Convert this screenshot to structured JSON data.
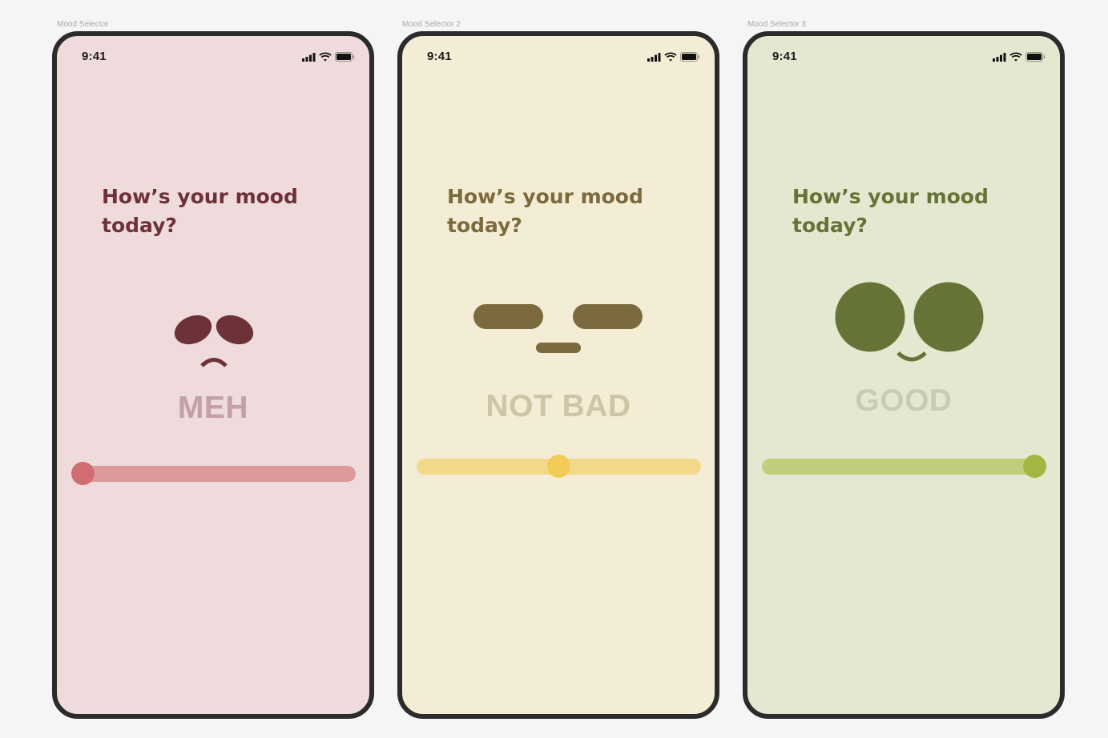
{
  "screens": [
    {
      "frame_label": "Mood Selector",
      "time": "9:41",
      "question": "How’s your mood today?",
      "mood": "MEH",
      "slider_value": 0,
      "colors": {
        "background": "#efdadc",
        "question": "#6d3237",
        "face": "#6d3237",
        "mood_word": "#c3a0a5",
        "track": "#dd9a9c",
        "thumb": "#d06c72"
      }
    },
    {
      "frame_label": "Mood Selector 2",
      "time": "9:41",
      "question": "How’s your mood today?",
      "mood": "NOT BAD",
      "slider_value": 0.5,
      "colors": {
        "background": "#f4edd5",
        "question": "#7b6a3d",
        "face": "#7b6a3d",
        "mood_word": "#cdc5a6",
        "track": "#f2d98a",
        "thumb": "#f0cb56"
      }
    },
    {
      "frame_label": "Mood Selector 3",
      "time": "9:41",
      "question": "How’s your mood today?",
      "mood": "GOOD",
      "slider_value": 1,
      "colors": {
        "background": "#e4e8d1",
        "question": "#667336",
        "face": "#667336",
        "mood_word": "#c9ccb2",
        "track": "#c0cd7c",
        "thumb": "#a5b640"
      }
    }
  ]
}
